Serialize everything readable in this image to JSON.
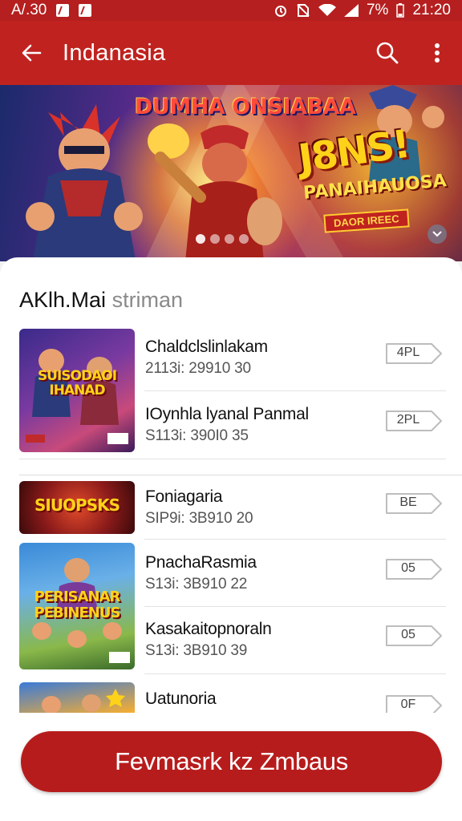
{
  "status_bar": {
    "time_left": "A/.30",
    "battery": "7%",
    "time_right": "21:20"
  },
  "app_bar": {
    "title": "Indanasia"
  },
  "banner": {
    "title": "DUMHA ONSIABAA",
    "badge_main": "J8NS!",
    "badge_sub": "PANAIHAUOSA",
    "badge_tag": "DAOR IREEC",
    "page_dots": 4,
    "active_dot": 0
  },
  "section": {
    "title_bold": "AKlh.Mai",
    "title_muted": "striman"
  },
  "thumbnails": [
    {
      "text": "SUISODAOI IHANAD"
    },
    {
      "text": "SIUOPSKS"
    },
    {
      "text": "PERISANAR PEBINENUS"
    },
    {
      "text": ""
    }
  ],
  "items": [
    {
      "name": "Chaldclslinlakam",
      "meta": "2113i: 29910 30",
      "badge": "4PL"
    },
    {
      "name": "IOynhla lyanal Panmal",
      "meta": "S113i: 390I0 35",
      "badge": "2PL"
    },
    {
      "name": "Foniagaria",
      "meta": "SIP9i: 3B910 20",
      "badge": "BE"
    },
    {
      "name": "PnachaRasmia",
      "meta": "S13i: 3B910 22",
      "badge": "05"
    },
    {
      "name": "Kasakaitopnoraln",
      "meta": "S13i: 3B910 39",
      "badge": "05"
    },
    {
      "name": "Uatunoria",
      "meta": "",
      "badge": "0F"
    }
  ],
  "cta": {
    "label": "Fevmasrk kz Zmbaus"
  },
  "colors": {
    "app_bar": "#c0231f",
    "status_bar": "#b51f1f",
    "cta": "#b71c1c"
  },
  "icons": [
    "back-arrow-icon",
    "search-icon",
    "more-vert-icon",
    "wifi-icon",
    "signal-icon",
    "battery-icon",
    "alarm-icon",
    "chevron-down-icon"
  ]
}
